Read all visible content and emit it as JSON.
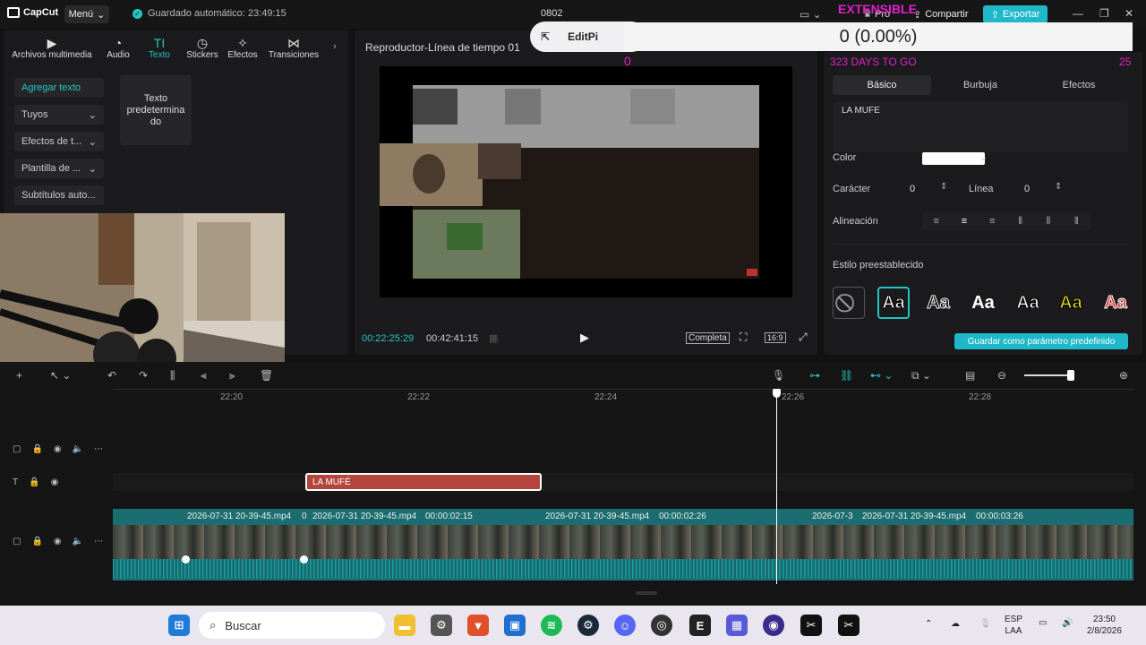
{
  "titlebar": {
    "app_name": "CapCut",
    "menu_label": "Menú",
    "autosave": "Guardado automático: 23:49:15",
    "project_title": "0802",
    "pro_label": "Pro",
    "share_label": "Compartir",
    "export_label": "Exportar"
  },
  "left_tabs": [
    {
      "label": "Archivos multimedia",
      "icon": "media-icon"
    },
    {
      "label": "Audio",
      "icon": "audio-icon"
    },
    {
      "label": "Texto",
      "icon": "text-icon"
    },
    {
      "label": "Stickers",
      "icon": "sticker-icon"
    },
    {
      "label": "Efectos",
      "icon": "effects-icon"
    },
    {
      "label": "Transiciones",
      "icon": "transitions-icon"
    }
  ],
  "left_sidebar": [
    {
      "label": "Agregar texto"
    },
    {
      "label": "Tuyos"
    },
    {
      "label": "Efectos de t..."
    },
    {
      "label": "Plantilla de ..."
    },
    {
      "label": "Subtítulos auto..."
    }
  ],
  "text_card": "Texto predetermina do",
  "player": {
    "title": "Reproductor-Línea de tiempo 01",
    "time_current": "00:22:25:29",
    "time_total": "00:42:41:15",
    "full_label": "Completa",
    "ratio_label": "16:9"
  },
  "editpi_label": "EditPi",
  "overlay": {
    "extensible": "EXTENSIBLE",
    "counter": "0 (0.00%)",
    "left_num": "0",
    "days_to_go": "323 DAYS TO GO",
    "right_num": "25"
  },
  "right_panel": {
    "tabs": [
      "Básico",
      "Burbuja",
      "Efectos"
    ],
    "text_value": "LA MUFE",
    "color_label": "Color",
    "char_label": "Carácter",
    "char_value": "0",
    "line_label": "Línea",
    "line_value": "0",
    "align_label": "Alineación",
    "preset_label": "Estilo preestablecido",
    "preset_sample": "Aa",
    "save_preset_label": "Guardar como parámetro predefinido"
  },
  "timeline": {
    "ruler": [
      "22:20",
      "22:22",
      "22:24",
      "22:26",
      "22:28"
    ],
    "text_clip": "LA MUFÉ",
    "clips": [
      {
        "label": "2026-07-31 20-39-45.mp4"
      },
      {
        "label": "0"
      },
      {
        "label": "2026-07-31 20-39-45.mp4"
      },
      {
        "label": "00:00:02:15"
      },
      {
        "label": "2026-07-31 20-39-45.mp4"
      },
      {
        "label": "00:00:02:26"
      },
      {
        "label": "2026-07-3"
      },
      {
        "label": "2026-07-31 20-39-45.mp4"
      },
      {
        "label": "00:00:03:26"
      }
    ]
  },
  "taskbar": {
    "search_placeholder": "Buscar",
    "lang_top": "ESP",
    "lang_bottom": "LAA",
    "clock_time": "23:50",
    "clock_date": "2/8/2026"
  },
  "colors": {
    "accent": "#22c5c5",
    "export": "#1fb8c8",
    "text_clip": "#b3453d",
    "overlay_magenta": "#e020c8"
  }
}
